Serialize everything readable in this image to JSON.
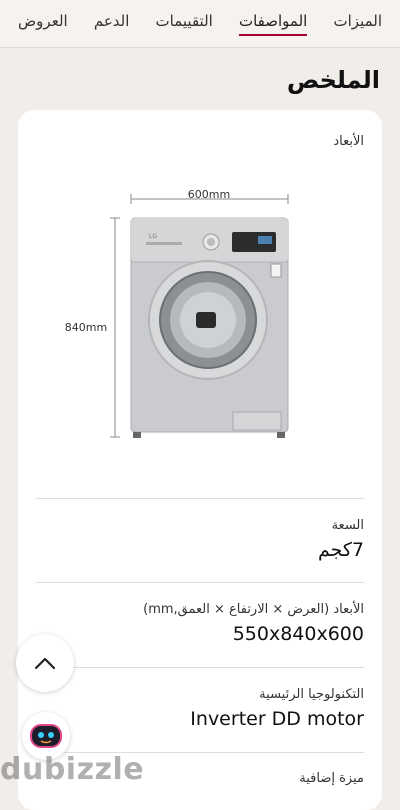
{
  "tabs": [
    {
      "label": "الميزات",
      "active": false
    },
    {
      "label": "المواصفات",
      "active": true
    },
    {
      "label": "التقييمات",
      "active": false
    },
    {
      "label": "الدعم",
      "active": false
    },
    {
      "label": "العروض",
      "active": false
    }
  ],
  "page_title": "الملخص",
  "dimensions_section": {
    "label": "الأبعاد",
    "width_label": "600mm",
    "height_label": "840mm"
  },
  "specs": [
    {
      "label": "السعة",
      "value": "7كجم"
    },
    {
      "label": "الأبعاد (العرض × الارتفاع × العمق,mm)",
      "value": "550x840x600"
    },
    {
      "label": "التكنولوجيا الرئيسية",
      "value": "Inverter DD motor"
    },
    {
      "label": "ميزة إضافية",
      "value": ""
    }
  ],
  "icons": {
    "scroll_top": "chevron-up-icon",
    "chatbot": "chatbot-icon"
  },
  "watermark": "dubizzle",
  "colors": {
    "accent": "#a50034",
    "background": "#f1ede8",
    "card": "#ffffff"
  }
}
